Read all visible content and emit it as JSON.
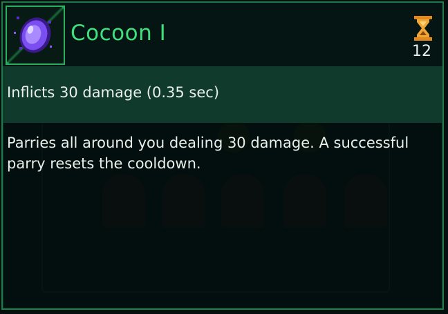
{
  "ability": {
    "name": "Cocoon I",
    "icon": "cocoon-orb-icon",
    "cooldown_icon": "hourglass-icon",
    "cooldown": "12",
    "damage_line": "Inflicts 30 damage (0.35 sec)",
    "description": "Parries all around you dealing 30 damage. A successful parry resets the cooldown."
  },
  "colors": {
    "accent": "#3fe07e",
    "border": "#28b062",
    "damage_band": "#103a2c",
    "orb": "#8a5cff",
    "hourglass": "#e08a1e"
  }
}
